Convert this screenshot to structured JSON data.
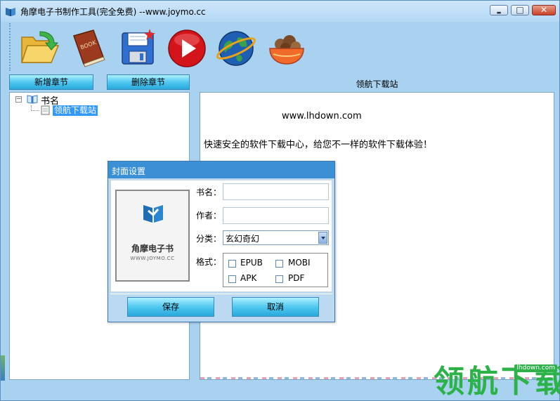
{
  "window": {
    "title": "角摩电子书制作工具(完全免费)  --www.joymo.cc",
    "minimize_glyph": "▬",
    "maximize_glyph": "□",
    "close_glyph": "✕"
  },
  "toolbar": {
    "tools": [
      {
        "name": "open-folder-icon"
      },
      {
        "name": "book-icon",
        "text": "BOOK"
      },
      {
        "name": "save-disk-icon"
      },
      {
        "name": "play-icon"
      },
      {
        "name": "globe-icon"
      },
      {
        "name": "bowl-icon"
      }
    ]
  },
  "chapters": {
    "add_label": "新增章节",
    "delete_label": "删除章节"
  },
  "tree": {
    "expander": "−",
    "root_label": "书名",
    "child_label": "领航下载站"
  },
  "content": {
    "title": "领航下载站",
    "url": "www.lhdown.com",
    "description": "快速安全的软件下载中心，给您不一样的软件下载体验！"
  },
  "cover_dialog": {
    "title": "封面设置",
    "cover_name": "角摩电子书",
    "cover_sub": "WWW.JOYMO.CC",
    "labels": {
      "name": "书名：",
      "author": "作者：",
      "category": "分类：",
      "format": "格式："
    },
    "name_value": "",
    "author_value": "",
    "category_value": "玄幻奇幻",
    "formats": [
      "EPUB",
      "MOBI",
      "APK",
      "PDF"
    ],
    "save_label": "保存",
    "cancel_label": "取消"
  },
  "watermark": {
    "text": "领航下载",
    "url": "lhdown.com"
  },
  "colors": {
    "window_bg": "#a9d2f1",
    "button_gradient_mid": "#4fc8f0",
    "dialog_title": "#3a8fd5",
    "selection": "#3399ff",
    "watermark": "#2db24a"
  }
}
